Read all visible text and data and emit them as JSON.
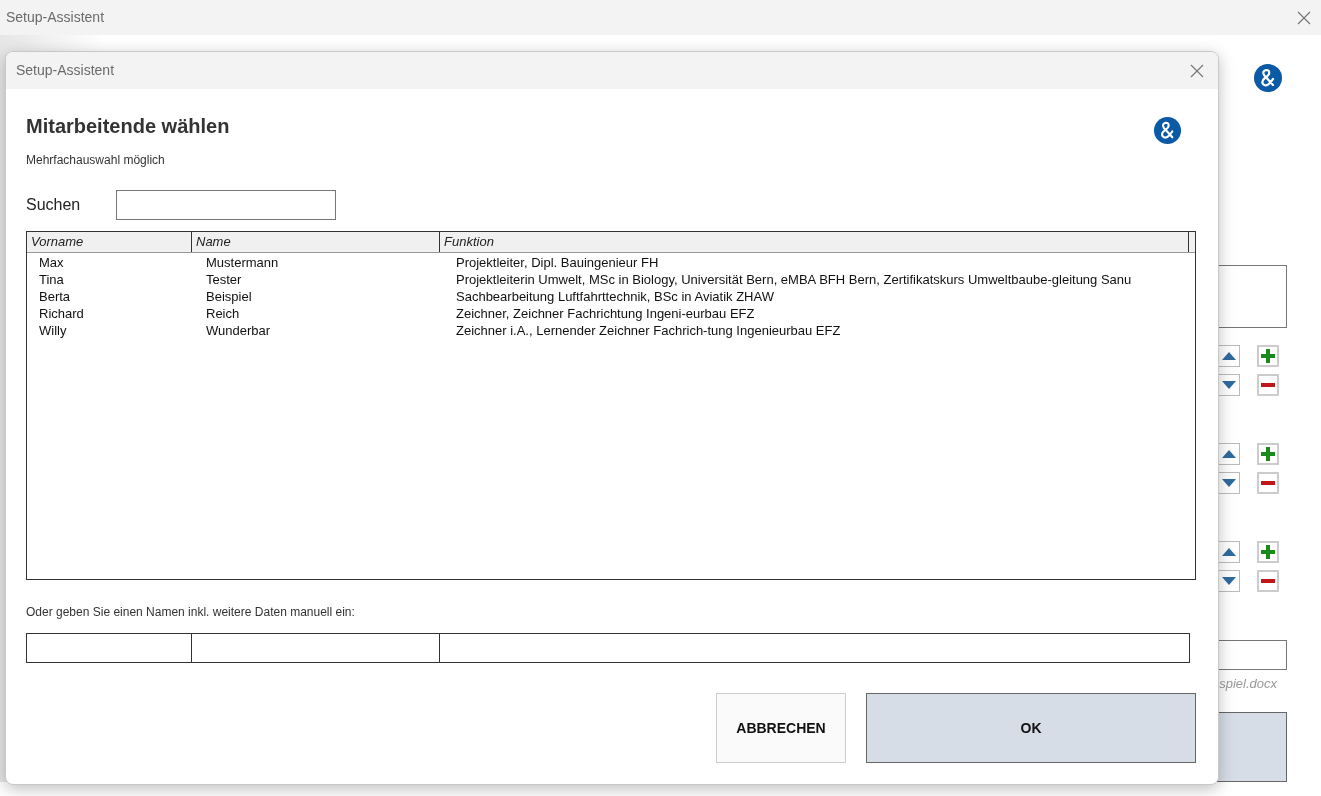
{
  "background_window": {
    "title": "Setup-Assistent",
    "file_name": "spiel.docx"
  },
  "dialog": {
    "title": "Setup-Assistent",
    "heading": "Mitarbeitende wählen",
    "subtitle": "Mehrfachauswahl möglich",
    "search": {
      "label": "Suchen"
    },
    "table": {
      "columns": [
        "Vorname",
        "Name",
        "Funktion"
      ],
      "rows": [
        {
          "cells": [
            "Max",
            "Mustermann",
            "Projektleiter, Dipl. Bauingenieur FH"
          ]
        },
        {
          "cells": [
            "Tina",
            "Tester",
            "Projektleiterin Umwelt, MSc in Biology, Universität Bern, eMBA BFH Bern, Zertifikatskurs Umweltbaube-gleitung Sanu"
          ]
        },
        {
          "cells": [
            "Berta",
            "Beispiel",
            "Sachbearbeitung Luftfahrttechnik, BSc in Aviatik ZHAW"
          ]
        },
        {
          "cells": [
            "Richard",
            "Reich",
            "Zeichner, Zeichner Fachrichtung Ingeni-eurbau EFZ"
          ]
        },
        {
          "cells": [
            "Willy",
            "Wunderbar",
            "Zeichner i.A., Lernender Zeichner Fachrich-tung Ingenieurbau EFZ"
          ]
        }
      ]
    },
    "manual_hint": "Oder geben Sie einen Namen inkl. weitere Daten manuell ein:",
    "buttons": [
      {
        "label": "ABBRECHEN",
        "kind": "secondary"
      },
      {
        "label": "OK",
        "kind": "primary"
      }
    ]
  }
}
